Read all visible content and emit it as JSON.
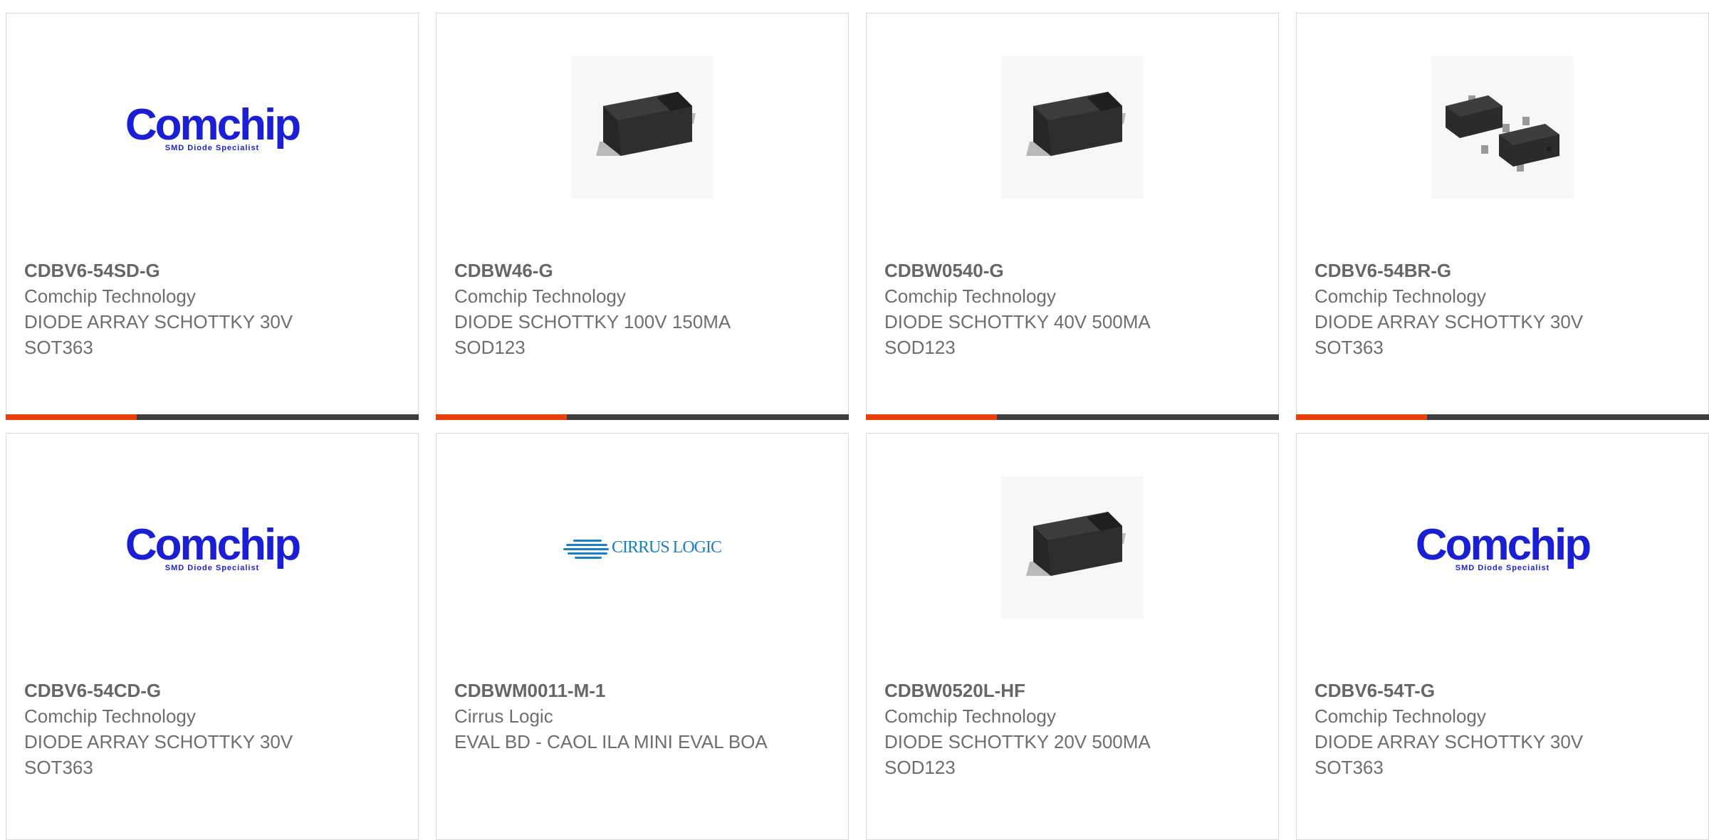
{
  "products": [
    {
      "part_number": "CDBV6-54SD-G",
      "manufacturer": "Comchip Technology",
      "description": "DIODE ARRAY SCHOTTKY 30V SOT363",
      "image": "comchip-logo",
      "image_text": "Comchip",
      "image_subtext": "SMD Diode Specialist"
    },
    {
      "part_number": "CDBW46-G",
      "manufacturer": "Comchip Technology",
      "description": "DIODE SCHOTTKY 100V 150MA SOD123",
      "image": "sod123-package"
    },
    {
      "part_number": "CDBW0540-G",
      "manufacturer": "Comchip Technology",
      "description": "DIODE SCHOTTKY 40V 500MA SOD123",
      "image": "sod123-package"
    },
    {
      "part_number": "CDBV6-54BR-G",
      "manufacturer": "Comchip Technology",
      "description": "DIODE ARRAY SCHOTTKY 30V SOT363",
      "image": "sot-package-pair"
    },
    {
      "part_number": "CDBV6-54CD-G",
      "manufacturer": "Comchip Technology",
      "description": "DIODE ARRAY SCHOTTKY 30V SOT363",
      "image": "comchip-logo",
      "image_text": "Comchip",
      "image_subtext": "SMD Diode Specialist"
    },
    {
      "part_number": "CDBWM0011-M-1",
      "manufacturer": "Cirrus Logic",
      "description": "EVAL BD - CAOL ILA MINI EVAL BOA",
      "image": "cirrus-logic-logo",
      "image_text": "CIRRUS LOGIC"
    },
    {
      "part_number": "CDBW0520L-HF",
      "manufacturer": "Comchip Technology",
      "description": "DIODE SCHOTTKY 20V 500MA SOD123",
      "image": "sod123-package"
    },
    {
      "part_number": "CDBV6-54T-G",
      "manufacturer": "Comchip Technology",
      "description": "DIODE ARRAY SCHOTTKY 30V SOT363",
      "image": "comchip-logo",
      "image_text": "Comchip",
      "image_subtext": "SMD Diode Specialist"
    }
  ],
  "colors": {
    "accent": "#e8400c",
    "bar_dark": "#3d3d3d",
    "logo_blue": "#1a1fd6",
    "cirrus_blue": "#1b7fc7"
  }
}
